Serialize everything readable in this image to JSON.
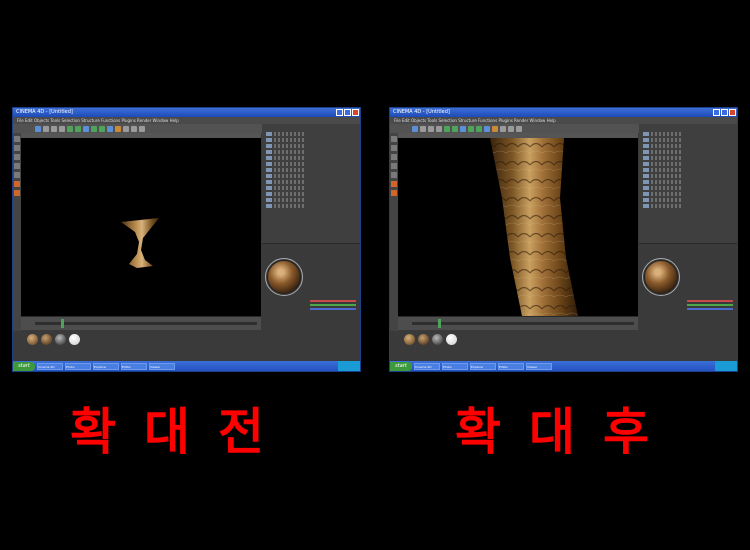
{
  "screenshots": [
    {
      "id": "before",
      "title": "CINEMA 4D - [Untitled]",
      "menu": "File  Edit  Objects  Tools  Selection  Structure  Functions  Plugins  Render  Window  Help",
      "start_label": "start",
      "tasks": [
        "Cinema 4D",
        "Photo",
        "Explorer",
        "Editor",
        "Viewer"
      ]
    },
    {
      "id": "after",
      "title": "CINEMA 4D - [Untitled]",
      "menu": "File  Edit  Objects  Tools  Selection  Structure  Functions  Plugins  Render  Window  Help",
      "start_label": "start",
      "tasks": [
        "Cinema 4D",
        "Photo",
        "Explorer",
        "Editor",
        "Viewer"
      ]
    }
  ],
  "captions": {
    "before": "확대전",
    "after": "확대후"
  },
  "colors": {
    "caption": "#ff0000",
    "wood_light": "#c9a060",
    "wood_dark": "#4a3012"
  }
}
